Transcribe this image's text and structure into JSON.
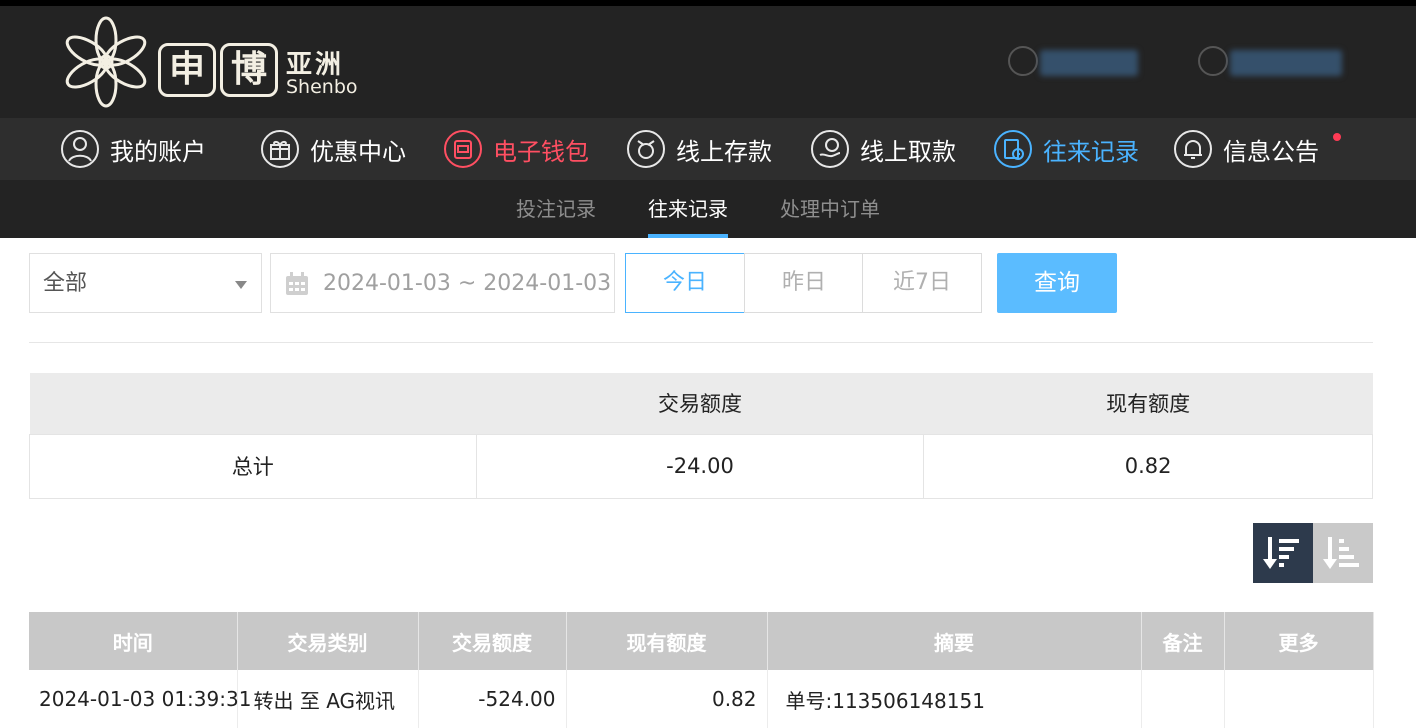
{
  "brand": {
    "char1": "申",
    "char2": "博",
    "suffix": "亚洲",
    "english": "Shenbo"
  },
  "nav": [
    {
      "label": "我的账户",
      "icon": "user-circle-icon"
    },
    {
      "label": "优惠中心",
      "icon": "gift-icon"
    },
    {
      "label": "电子钱包",
      "icon": "wallet-icon",
      "color": "#ff4f62"
    },
    {
      "label": "线上存款",
      "icon": "deposit-icon"
    },
    {
      "label": "线上取款",
      "icon": "withdraw-icon"
    },
    {
      "label": "往来记录",
      "icon": "records-icon",
      "color": "#4ab3ff"
    },
    {
      "label": "信息公告",
      "icon": "bell-icon"
    }
  ],
  "subnav": [
    {
      "label": "投注记录"
    },
    {
      "label": "往来记录",
      "active": true
    },
    {
      "label": "处理中订单"
    }
  ],
  "filter": {
    "type_value": "全部",
    "date_range": "2024-01-03 ~ 2024-01-03",
    "quick": [
      "今日",
      "昨日",
      "近7日"
    ],
    "search_label": "查询"
  },
  "summary": {
    "headers": [
      "",
      "交易额度",
      "现有额度"
    ],
    "row": {
      "label": "总计",
      "amount": "-24.00",
      "balance": "0.82"
    }
  },
  "table": {
    "headers": [
      "时间",
      "交易类别",
      "交易额度",
      "现有额度",
      "摘要",
      "备注",
      "更多"
    ],
    "rows": [
      {
        "time": "2024-01-03 01:39:31",
        "category": "转出 至 AG视讯",
        "amount": "-524.00",
        "balance": "0.82",
        "summary": "单号:113506148151",
        "note": "",
        "more": ""
      }
    ]
  },
  "colors": {
    "accent": "#4ab3ff",
    "wallet": "#ff4f62",
    "header_bg": "#232323",
    "nav_bg": "#2e2e2e"
  }
}
